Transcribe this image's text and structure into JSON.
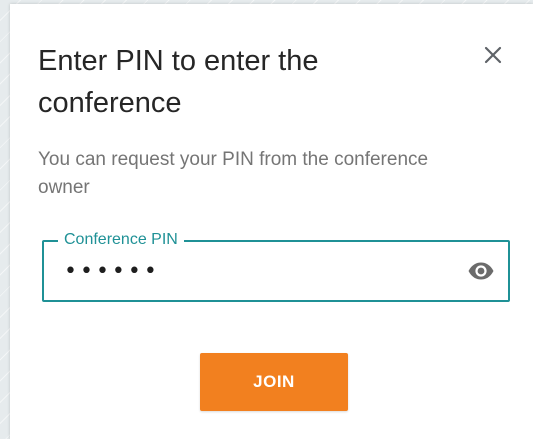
{
  "dialog": {
    "title": "Enter PIN to enter the conference",
    "subtitle": "You can request your PIN from the conference owner",
    "close_icon": "close-icon",
    "pin_field": {
      "label": "Conference PIN",
      "value": "123456",
      "type": "password",
      "toggle_icon": "eye-icon"
    },
    "join_label": "JOIN"
  },
  "colors": {
    "accent": "#1f9196",
    "button": "#f2801f",
    "title_text": "#262626",
    "subtitle_text": "#757575"
  }
}
